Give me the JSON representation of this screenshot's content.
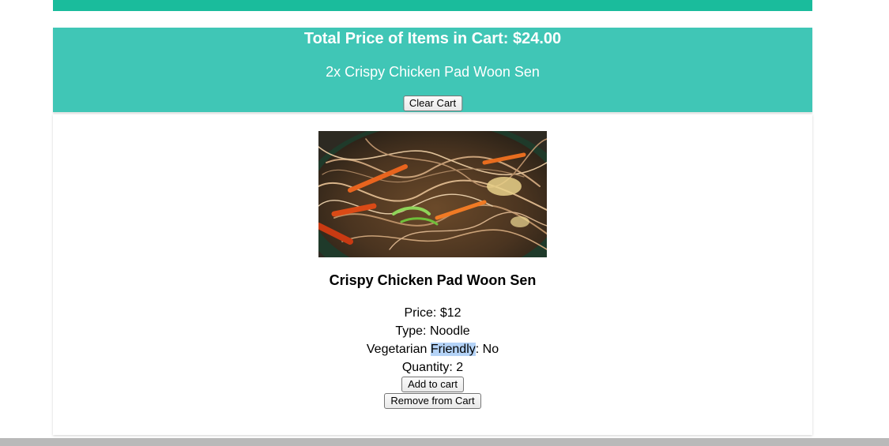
{
  "cart": {
    "total_label": "Total Price of Items in Cart: $24.00",
    "items": [
      "2x Crispy Chicken Pad Woon Sen"
    ],
    "clear_label": "Clear Cart"
  },
  "product": {
    "name": "Crispy Chicken Pad Woon Sen",
    "image_alt": "Crispy Chicken Pad Woon Sen noodle dish",
    "price_label": "Price: $12",
    "type_label": "Type: Noodle",
    "vegetarian_prefix": "Vegetarian ",
    "vegetarian_highlight": "Friendly",
    "vegetarian_suffix": ": No",
    "quantity_label": "Quantity: 2",
    "add_label": "Add to cart",
    "remove_label": "Remove from Cart"
  },
  "colors": {
    "top_bar": "#1abc9c",
    "cart_panel": "#40c6b6",
    "selection_highlight": "#b4d3f7"
  }
}
